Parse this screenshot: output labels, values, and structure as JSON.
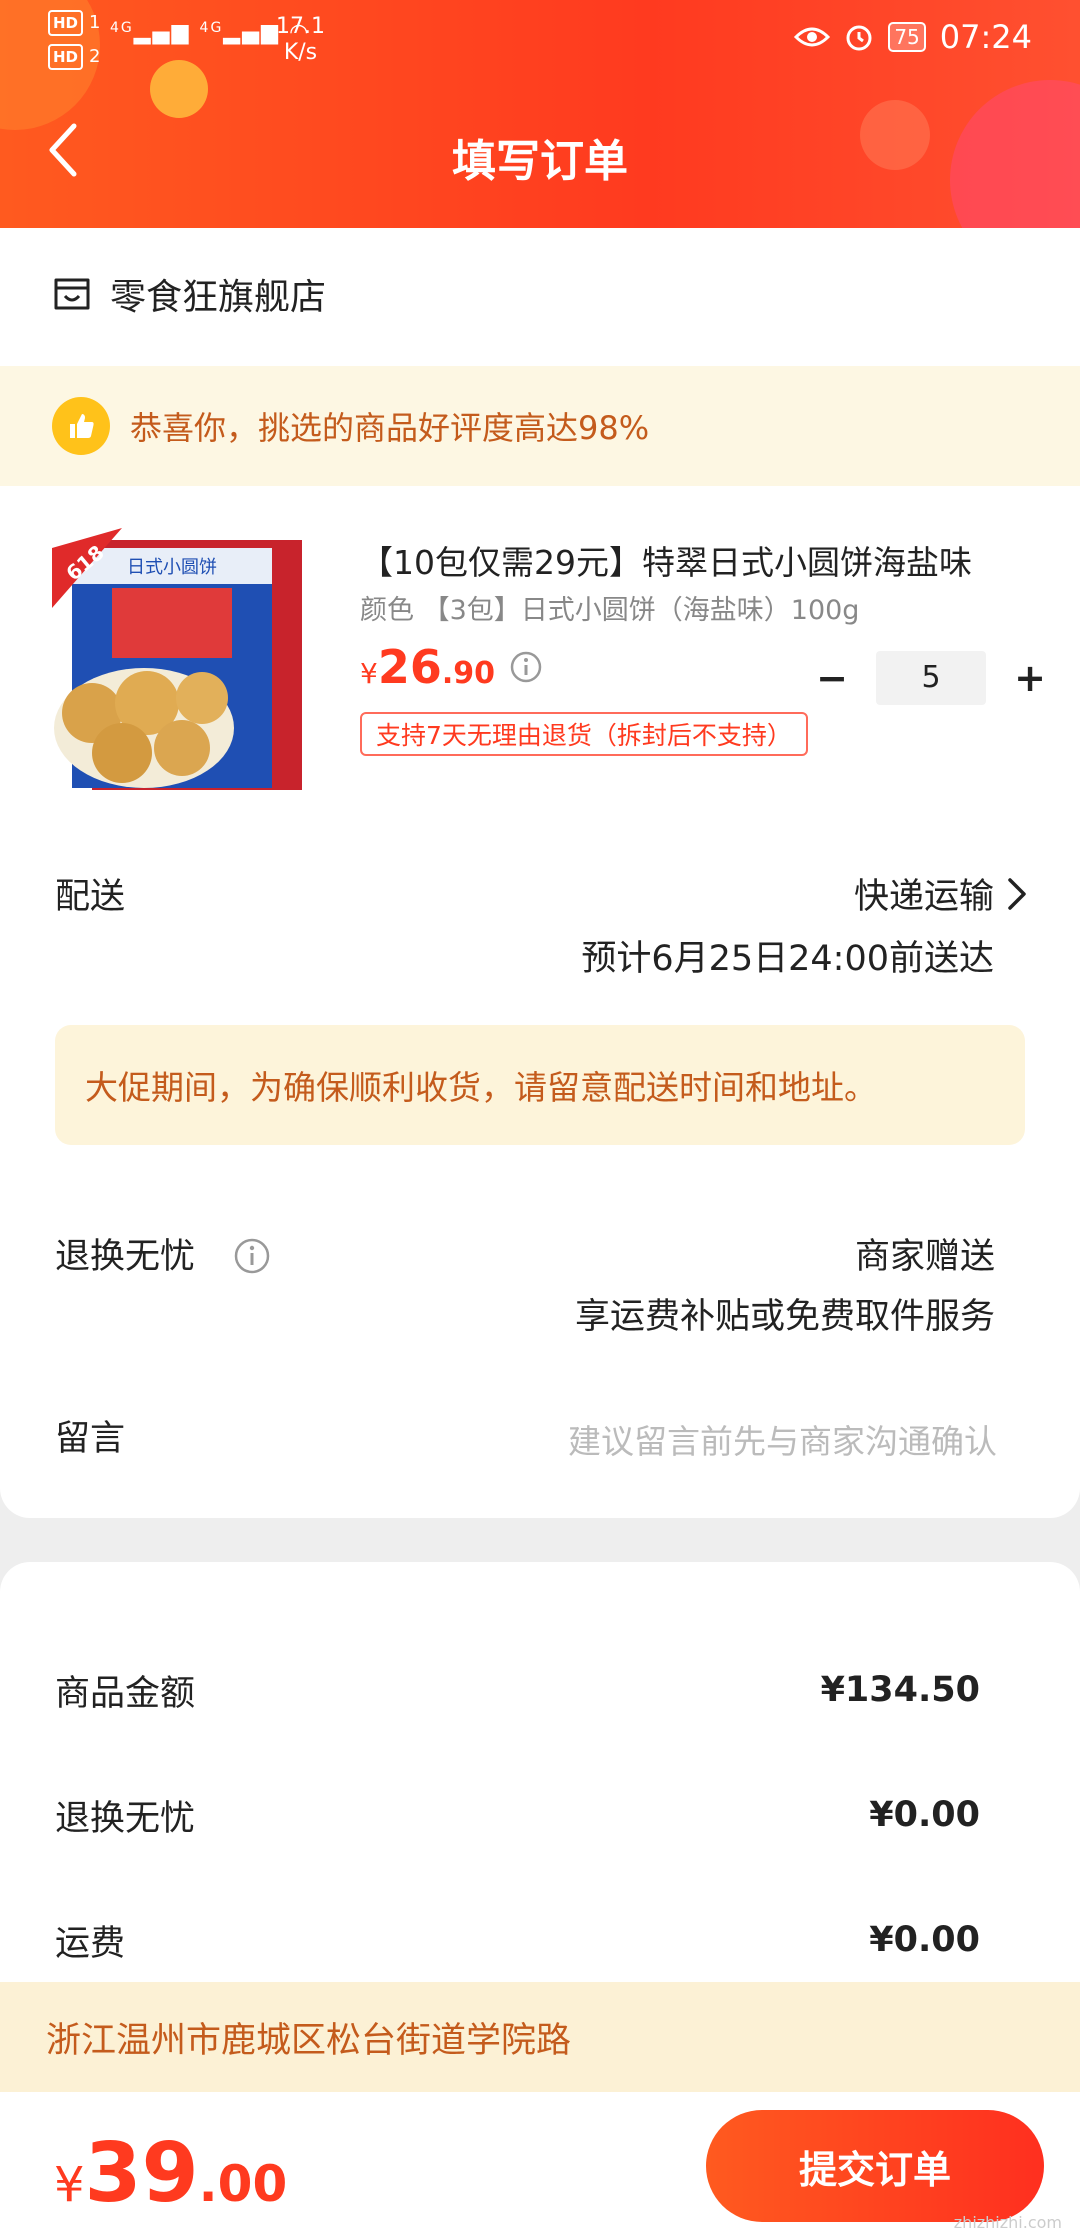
{
  "status_bar": {
    "hd1": "HD",
    "hd2": "HD",
    "sim1": "1",
    "sim2": "2",
    "net1": "4G",
    "net2": "4G",
    "speed_value": "17.1",
    "speed_unit": "K/s",
    "battery": "75",
    "time": "07:24"
  },
  "header": {
    "title": "填写订单"
  },
  "store": {
    "name": "零食狂旗舰店"
  },
  "praise": {
    "text": "恭喜你，挑选的商品好评度高达98%"
  },
  "product": {
    "title": "【10包仅需29元】特翠日式小圆饼海盐味",
    "spec": "颜色 【3包】日式小圆饼（海盐味）100g",
    "price_symbol": "¥",
    "price_int": "26",
    "price_dec": ".90",
    "quantity": "5",
    "minus": "−",
    "plus": "+",
    "return_tag": "支持7天无理由退货（拆封后不支持）",
    "image_badge": "618",
    "image_text": "日式小圆饼"
  },
  "delivery": {
    "label": "配送",
    "method": "快递运输",
    "eta": "预计6月25日24:00前送达"
  },
  "notice": {
    "text": "大促期间，为确保顺利收货，请留意配送时间和地址。"
  },
  "return_worry_free": {
    "label": "退换无忧",
    "line1": "商家赠送",
    "line2": "享运费补贴或免费取件服务"
  },
  "message": {
    "label": "留言",
    "placeholder": "建议留言前先与商家沟通确认"
  },
  "summary": {
    "goods_label": "商品金额",
    "goods_value": "¥134.50",
    "return_label": "退换无忧",
    "return_value": "¥0.00",
    "shipping_label": "运费",
    "shipping_value": "¥0.00"
  },
  "address": {
    "text": "浙江温州市鹿城区松台街道学院路"
  },
  "footer": {
    "total_symbol": "¥",
    "total_int": "39",
    "total_dec": ".00",
    "submit_label": "提交订单",
    "watermark": "zhizhizhi.com"
  },
  "colors": {
    "accent": "#ff3a1f",
    "warning_text": "#c45b1c",
    "notice_bg": "#fdf4da"
  }
}
